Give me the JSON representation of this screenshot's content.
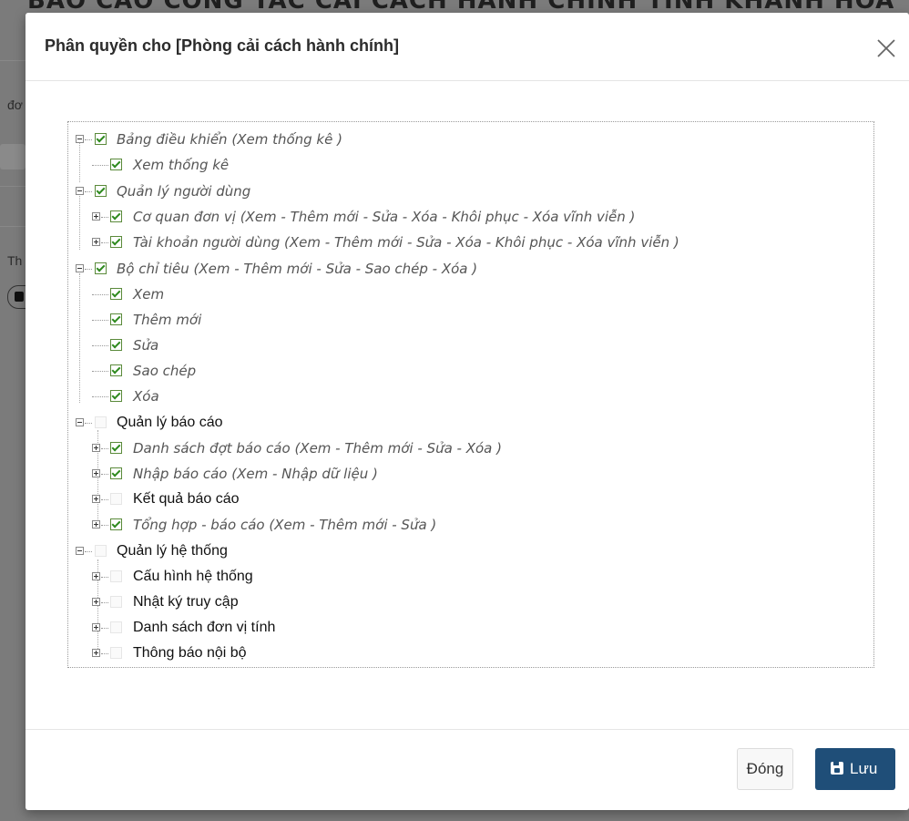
{
  "background": {
    "title": "BÁO CÁO CÔNG TÁC CẢI CÁCH HÀNH CHÍNH TỈNH KHÁNH HÒA",
    "frag_a": "đơ",
    "frag_b": "Th"
  },
  "modal": {
    "title": "Phân quyền cho [Phòng cải cách hành chính]",
    "close_icon": "close-icon"
  },
  "tree": {
    "n1": {
      "label": "Bảng điều khiển (Xem thống kê )",
      "checked": true
    },
    "n1_1": {
      "label": "Xem thống kê",
      "checked": true
    },
    "n2": {
      "label": "Quản lý người dùng",
      "checked": true
    },
    "n2_1": {
      "label": "Cơ quan đơn vị (Xem - Thêm mới - Sửa - Xóa - Khôi phục - Xóa vĩnh viễn )",
      "checked": true
    },
    "n2_2": {
      "label": "Tài khoản người dùng (Xem - Thêm mới - Sửa - Xóa - Khôi phục - Xóa vĩnh viễn )",
      "checked": true
    },
    "n3": {
      "label": "Bộ chỉ tiêu (Xem - Thêm mới - Sửa - Sao chép - Xóa )",
      "checked": true
    },
    "n3_1": {
      "label": "Xem",
      "checked": true
    },
    "n3_2": {
      "label": "Thêm mới",
      "checked": true
    },
    "n3_3": {
      "label": "Sửa",
      "checked": true
    },
    "n3_4": {
      "label": "Sao chép",
      "checked": true
    },
    "n3_5": {
      "label": "Xóa",
      "checked": true
    },
    "n4": {
      "label": "Quản lý báo cáo",
      "checked": false
    },
    "n4_1": {
      "label": "Danh sách đợt báo cáo (Xem - Thêm mới - Sửa - Xóa )",
      "checked": true
    },
    "n4_2": {
      "label": "Nhập báo cáo (Xem - Nhập dữ liệu )",
      "checked": true
    },
    "n4_3": {
      "label": "Kết quả báo cáo",
      "checked": false
    },
    "n4_4": {
      "label": "Tổng hợp - báo cáo (Xem - Thêm mới - Sửa )",
      "checked": true
    },
    "n5": {
      "label": "Quản lý hệ thống",
      "checked": false
    },
    "n5_1": {
      "label": "Cấu hình hệ thống",
      "checked": false
    },
    "n5_2": {
      "label": "Nhật ký truy cập",
      "checked": false
    },
    "n5_3": {
      "label": "Danh sách đơn vị tính",
      "checked": false
    },
    "n5_4": {
      "label": "Thông báo nội bộ",
      "checked": false
    }
  },
  "footer": {
    "close_label": "Đóng",
    "save_label": "Lưu"
  }
}
